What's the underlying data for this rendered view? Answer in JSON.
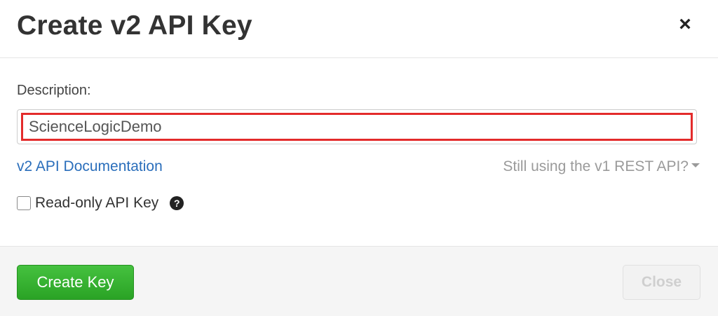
{
  "header": {
    "title": "Create v2 API Key",
    "close_glyph": "×",
    "close_icon": "close-icon"
  },
  "form": {
    "description_label": "Description:",
    "description_value": "ScienceLogicDemo",
    "description_highlight_color": "#e32b2b",
    "doc_link": "v2 API Documentation",
    "v1_toggle": "Still using the v1 REST API?",
    "v1_toggle_icon": "caret-down-icon",
    "readonly_label": "Read-only API Key",
    "readonly_checked": false,
    "help_glyph": "?",
    "help_icon": "question-circle-icon"
  },
  "footer": {
    "create_label": "Create Key",
    "close_label": "Close",
    "close_disabled": true
  },
  "colors": {
    "link": "#2a6ebb",
    "primary_button": "#2aa325",
    "title_text": "#333333"
  }
}
